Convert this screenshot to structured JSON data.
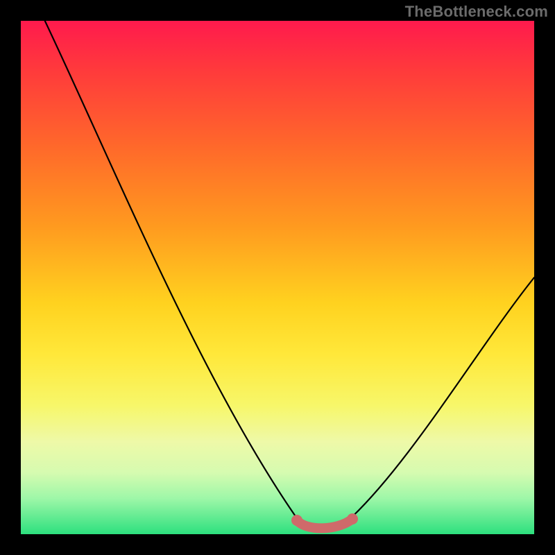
{
  "watermark": "TheBottleneck.com",
  "chart_data": {
    "type": "line",
    "title": "",
    "xlabel": "",
    "ylabel": "",
    "xlim": [
      0,
      100
    ],
    "ylim": [
      0,
      100
    ],
    "x": [
      0,
      5,
      10,
      15,
      20,
      25,
      30,
      35,
      40,
      45,
      50,
      55,
      57,
      60,
      62,
      65,
      70,
      75,
      80,
      85,
      90,
      95,
      100
    ],
    "values": [
      101,
      90,
      79,
      68,
      58,
      49,
      40,
      32,
      24,
      17,
      10,
      5,
      3,
      2,
      2,
      3,
      6,
      12,
      20,
      29,
      38,
      46,
      53
    ],
    "optimal_band_x": [
      55,
      65
    ],
    "colors": {
      "curve": "#000000",
      "highlight": "#d16a6a",
      "gradient_top": "#ff1a4d",
      "gradient_bottom": "#2de07e"
    }
  }
}
